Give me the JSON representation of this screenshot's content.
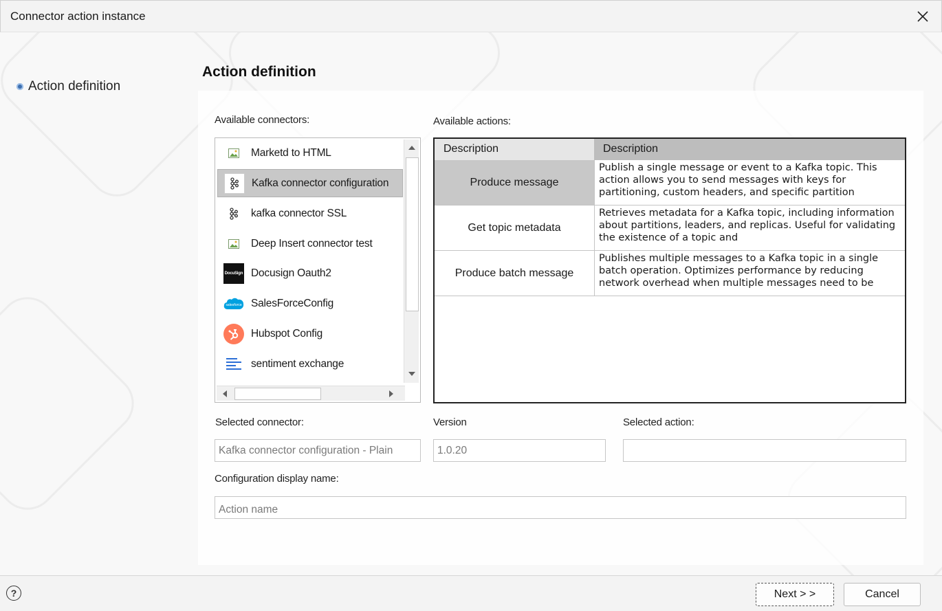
{
  "window": {
    "title": "Connector action instance"
  },
  "sidebar": {
    "steps": [
      {
        "label": "Action definition"
      }
    ]
  },
  "page": {
    "heading": "Action definition"
  },
  "connectors": {
    "label": "Available connectors:",
    "items": [
      {
        "label": "Marketd to HTML",
        "icon": "image-icon"
      },
      {
        "label": "Kafka connector configuration",
        "icon": "kafka-icon",
        "selected": true
      },
      {
        "label": "kafka connector SSL",
        "icon": "kafka-icon"
      },
      {
        "label": "Deep Insert connector test",
        "icon": "image-icon"
      },
      {
        "label": "Docusign Oauth2",
        "icon": "docusign-logo",
        "logo_text": "DocuSign"
      },
      {
        "label": "SalesForceConfig",
        "icon": "salesforce-logo",
        "logo_text": "salesforce"
      },
      {
        "label": "Hubspot Config",
        "icon": "hubspot-logo"
      },
      {
        "label": "sentiment exchange",
        "icon": "lines-icon"
      }
    ]
  },
  "actions": {
    "label": "Available actions:",
    "columns": [
      "Description",
      "Description"
    ],
    "rows": [
      {
        "name": "Produce message",
        "description": "Publish a single message or event to a Kafka topic. This action allows you to send messages with keys for partitioning, custom headers, and specific partition",
        "selected": true
      },
      {
        "name": "Get topic metadata",
        "description": "Retrieves metadata for a Kafka topic, including information about partitions, leaders, and replicas. Useful for validating the existence of a topic and"
      },
      {
        "name": "Produce batch message",
        "description": "Publishes multiple messages to a Kafka topic in a single batch operation. Optimizes performance by reducing network overhead when multiple messages need to be"
      }
    ]
  },
  "form": {
    "selected_connector_label": "Selected connector:",
    "selected_connector_value": "Kafka connector configuration - Plain",
    "version_label": "Version",
    "version_value": "1.0.20",
    "selected_action_label": "Selected action:",
    "selected_action_value": "",
    "display_name_label": "Configuration display name:",
    "display_name_placeholder": "Action name"
  },
  "footer": {
    "help_glyph": "?",
    "next_label": "Next > >",
    "cancel_label": "Cancel"
  },
  "colors": {
    "selected_bg": "#c8c8c8",
    "grid_header": "#bdbdbd",
    "hubspot": "#ff7a59",
    "salesforce": "#00a1e0",
    "lines": "#2b6ed6"
  }
}
